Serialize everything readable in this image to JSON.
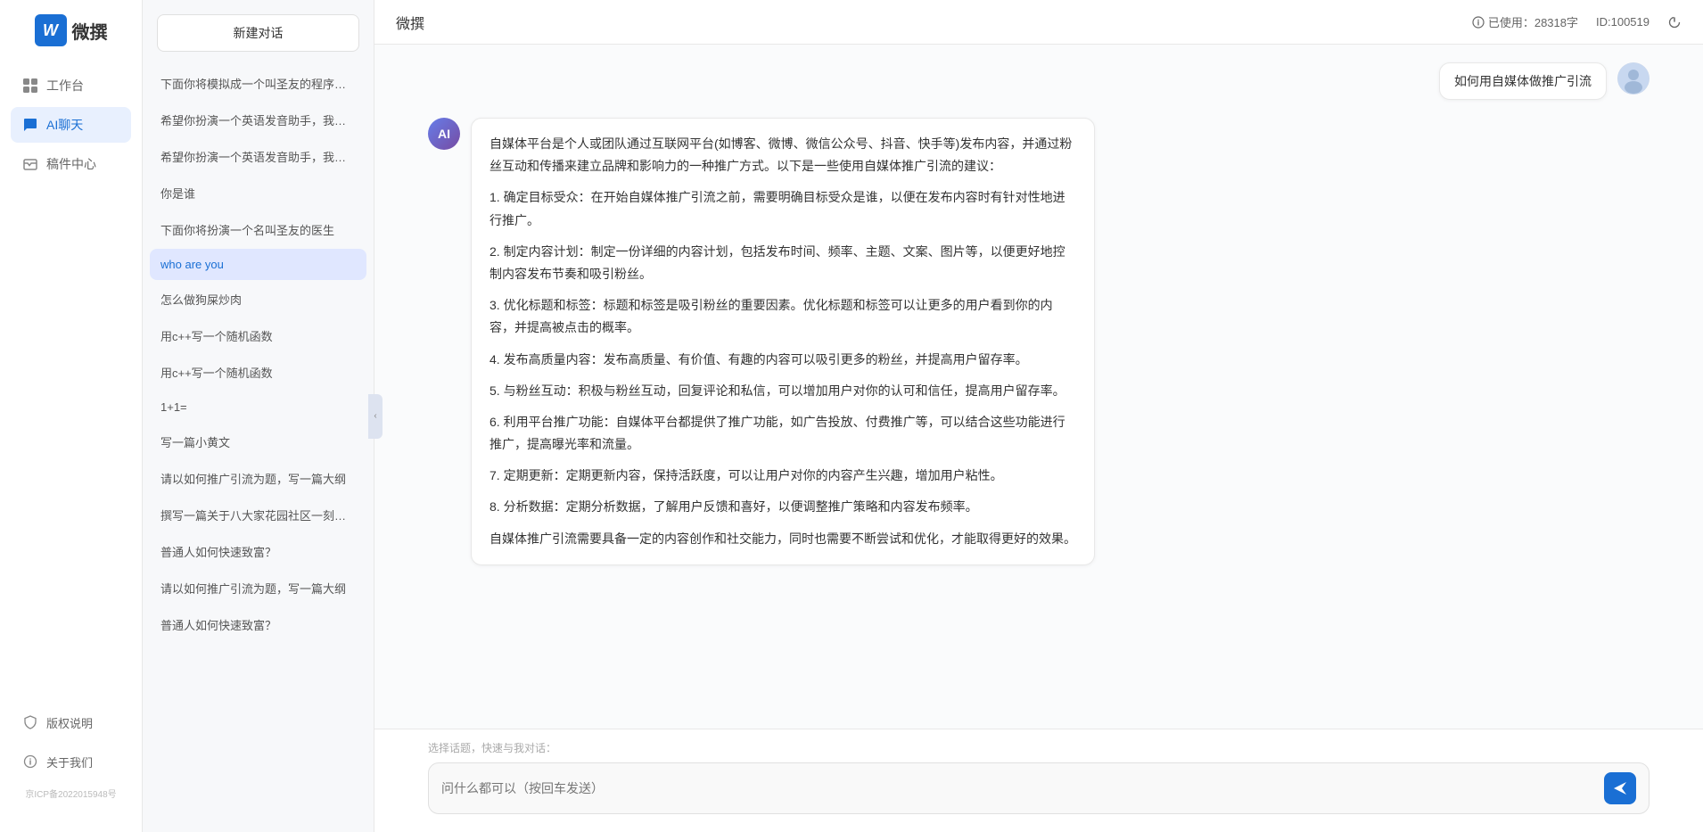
{
  "app": {
    "title": "微撰",
    "logo_letter": "W",
    "logo_text": "微撰"
  },
  "topbar": {
    "title": "微撰",
    "usage_label": "已使用：28318字",
    "id_label": "ID:100519",
    "usage_icon": "info-icon",
    "power_icon": "power-icon"
  },
  "sidebar": {
    "nav_items": [
      {
        "id": "workbench",
        "label": "工作台",
        "icon": "grid-icon"
      },
      {
        "id": "ai-chat",
        "label": "AI聊天",
        "icon": "chat-icon",
        "active": true
      },
      {
        "id": "mailbox",
        "label": "稿件中心",
        "icon": "inbox-icon"
      }
    ],
    "bottom_items": [
      {
        "id": "copyright",
        "label": "版权说明",
        "icon": "shield-icon"
      },
      {
        "id": "about",
        "label": "关于我们",
        "icon": "info-circle-icon"
      }
    ],
    "icp": "京ICP备2022015948号"
  },
  "chat_list": {
    "new_chat_label": "新建对话",
    "items": [
      {
        "id": 1,
        "text": "下面你将模拟成一个叫圣友的程序员，我说..."
      },
      {
        "id": 2,
        "text": "希望你扮演一个英语发音助手，我提供给你..."
      },
      {
        "id": 3,
        "text": "希望你扮演一个英语发音助手，我提供给你..."
      },
      {
        "id": 4,
        "text": "你是谁"
      },
      {
        "id": 5,
        "text": "下面你将扮演一个名叫圣友的医生"
      },
      {
        "id": 6,
        "text": "who are you",
        "active": true
      },
      {
        "id": 7,
        "text": "怎么做狗屎炒肉"
      },
      {
        "id": 8,
        "text": "用c++写一个随机函数"
      },
      {
        "id": 9,
        "text": "用c++写一个随机函数"
      },
      {
        "id": 10,
        "text": "1+1="
      },
      {
        "id": 11,
        "text": "写一篇小黄文"
      },
      {
        "id": 12,
        "text": "请以如何推广引流为题，写一篇大纲"
      },
      {
        "id": 13,
        "text": "撰写一篇关于八大家花园社区一刻钟便民生..."
      },
      {
        "id": 14,
        "text": "普通人如何快速致富？"
      },
      {
        "id": 15,
        "text": "请以如何推广引流为题，写一篇大纲"
      },
      {
        "id": 16,
        "text": "普通人如何快速致富？"
      }
    ]
  },
  "messages": [
    {
      "type": "user",
      "text": "如何用自媒体做推广引流"
    },
    {
      "type": "ai",
      "paragraphs": [
        "自媒体平台是个人或团队通过互联网平台(如博客、微博、微信公众号、抖音、快手等)发布内容，并通过粉丝互动和传播来建立品牌和影响力的一种推广方式。以下是一些使用自媒体推广引流的建议：",
        "1. 确定目标受众：在开始自媒体推广引流之前，需要明确目标受众是谁，以便在发布内容时有针对性地进行推广。",
        "2. 制定内容计划：制定一份详细的内容计划，包括发布时间、频率、主题、文案、图片等，以便更好地控制内容发布节奏和吸引粉丝。",
        "3. 优化标题和标签：标题和标签是吸引粉丝的重要因素。优化标题和标签可以让更多的用户看到你的内容，并提高被点击的概率。",
        "4. 发布高质量内容：发布高质量、有价值、有趣的内容可以吸引更多的粉丝，并提高用户留存率。",
        "5. 与粉丝互动：积极与粉丝互动，回复评论和私信，可以增加用户对你的认可和信任，提高用户留存率。",
        "6. 利用平台推广功能：自媒体平台都提供了推广功能，如广告投放、付费推广等，可以结合这些功能进行推广，提高曝光率和流量。",
        "7. 定期更新：定期更新内容，保持活跃度，可以让用户对你的内容产生兴趣，增加用户粘性。",
        "8. 分析数据：定期分析数据，了解用户反馈和喜好，以便调整推广策略和内容发布频率。",
        "自媒体推广引流需要具备一定的内容创作和社交能力，同时也需要不断尝试和优化，才能取得更好的效果。"
      ]
    }
  ],
  "input": {
    "quick_topics_label": "选择话题，快速与我对话：",
    "placeholder": "问什么都可以（按回车发送）",
    "send_icon": "send-icon"
  }
}
